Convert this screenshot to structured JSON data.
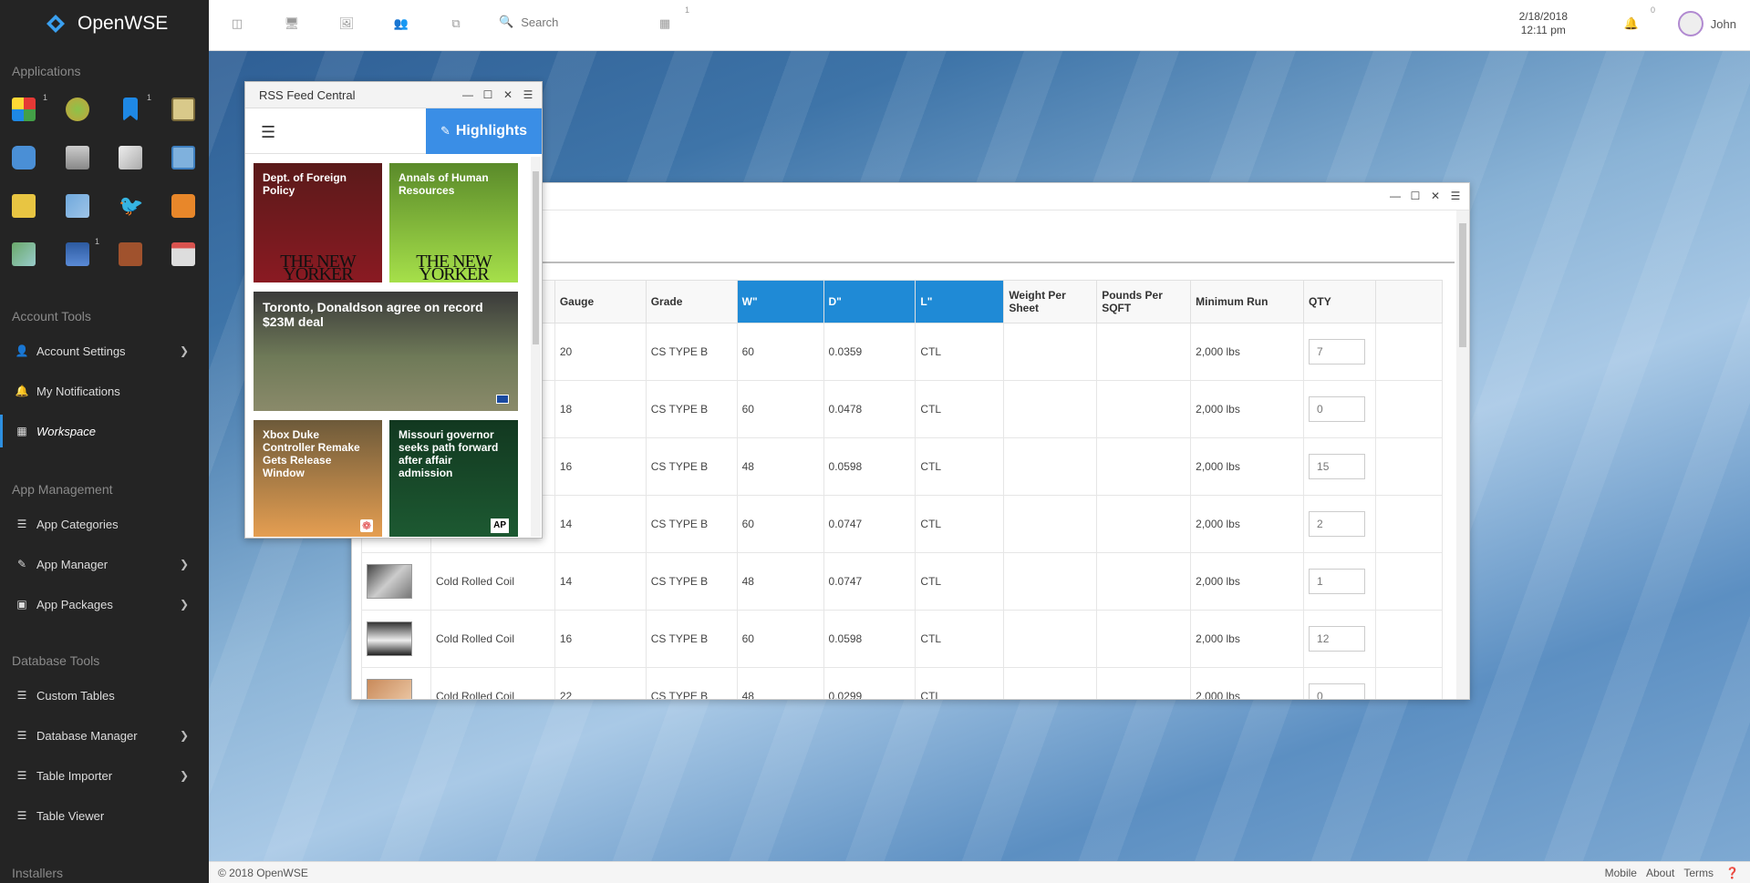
{
  "brand": {
    "name": "OpenWSE"
  },
  "sidebar": {
    "applications_title": "Applications",
    "app_badges": [
      "1",
      "1",
      "1"
    ],
    "account_tools_title": "Account Tools",
    "account_items": [
      {
        "label": "Account Settings"
      },
      {
        "label": "My Notifications"
      },
      {
        "label": "Workspace"
      }
    ],
    "app_management_title": "App Management",
    "app_management_items": [
      {
        "label": "App Categories"
      },
      {
        "label": "App Manager"
      },
      {
        "label": "App Packages"
      }
    ],
    "database_tools_title": "Database Tools",
    "database_items": [
      {
        "label": "Custom Tables"
      },
      {
        "label": "Database Manager"
      },
      {
        "label": "Table Importer"
      },
      {
        "label": "Table Viewer"
      }
    ],
    "installers_title": "Installers"
  },
  "topbar": {
    "search_placeholder": "Search",
    "apps_badge": "1",
    "date": "2/18/2018",
    "time": "12:11 pm",
    "notifications_badge": "0",
    "user_name": "John"
  },
  "rss": {
    "title": "RSS Feed Central",
    "highlights_label": "Highlights",
    "cards": [
      {
        "headline": "Dept. of Foreign Policy",
        "source": "THE NEW YORKER"
      },
      {
        "headline": "Annals of Human Resources",
        "source": "THE NEW YORKER"
      },
      {
        "headline": "Toronto, Donaldson agree on record $23M deal",
        "source": ""
      },
      {
        "headline": "Xbox Duke Controller Remake Gets Release Window",
        "source": ""
      },
      {
        "headline": "Missouri governor seeks path forward after affair admission",
        "source": "AP"
      }
    ]
  },
  "table": {
    "headers": [
      "",
      "",
      "Gauge",
      "Grade",
      "W\"",
      "D\"",
      "L\"",
      "Weight Per Sheet",
      "Pounds Per SQFT",
      "Minimum Run",
      "QTY",
      ""
    ],
    "rows": [
      {
        "product": "",
        "gauge": "20",
        "grade": "CS TYPE B",
        "w": "60",
        "d": "0.0359",
        "l": "CTL",
        "min_run": "2,000 lbs",
        "qty": "7"
      },
      {
        "product": "",
        "gauge": "18",
        "grade": "CS TYPE B",
        "w": "60",
        "d": "0.0478",
        "l": "CTL",
        "min_run": "2,000 lbs",
        "qty": "0"
      },
      {
        "product": "",
        "gauge": "16",
        "grade": "CS TYPE B",
        "w": "48",
        "d": "0.0598",
        "l": "CTL",
        "min_run": "2,000 lbs",
        "qty": "15"
      },
      {
        "product": "",
        "gauge": "14",
        "grade": "CS TYPE B",
        "w": "60",
        "d": "0.0747",
        "l": "CTL",
        "min_run": "2,000 lbs",
        "qty": "2"
      },
      {
        "product": "Cold Rolled Coil",
        "gauge": "14",
        "grade": "CS TYPE B",
        "w": "48",
        "d": "0.0747",
        "l": "CTL",
        "min_run": "2,000 lbs",
        "qty": "1"
      },
      {
        "product": "Cold Rolled Coil",
        "gauge": "16",
        "grade": "CS TYPE B",
        "w": "60",
        "d": "0.0598",
        "l": "CTL",
        "min_run": "2,000 lbs",
        "qty": "12"
      },
      {
        "product": "Cold Rolled Coil",
        "gauge": "22",
        "grade": "CS TYPE B",
        "w": "48",
        "d": "0.0299",
        "l": "CTL",
        "min_run": "2,000 lbs",
        "qty": "0"
      }
    ]
  },
  "footer": {
    "copyright": "© 2018 OpenWSE",
    "links": [
      "Mobile",
      "About",
      "Terms"
    ],
    "help_icon": "help-icon"
  },
  "colors": {
    "sidebar_bg": "#242424",
    "accent": "#1f8ad6",
    "highlights_bg": "#3a8ee6"
  }
}
